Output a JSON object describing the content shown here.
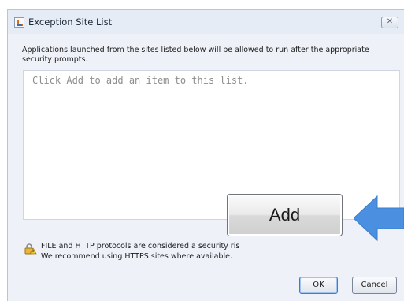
{
  "window": {
    "title": "Exception Site List",
    "title_icon": "java-icon",
    "close_label": "✕"
  },
  "description": "Applications launched from the sites listed below will be allowed to run after the appropriate security prompts.",
  "site_list": {
    "placeholder": "Click Add to add an item to this list.",
    "items": []
  },
  "add_button": {
    "label": "Add",
    "highlighted": true
  },
  "callout_arrow": {
    "color": "#4a8fe0",
    "direction": "left"
  },
  "security_note": {
    "icon": "lock-warning-icon",
    "line1": "FILE and HTTP protocols are considered a security ris",
    "line2": "We recommend using HTTPS sites where available."
  },
  "buttons": {
    "ok": "OK",
    "cancel": "Cancel"
  }
}
